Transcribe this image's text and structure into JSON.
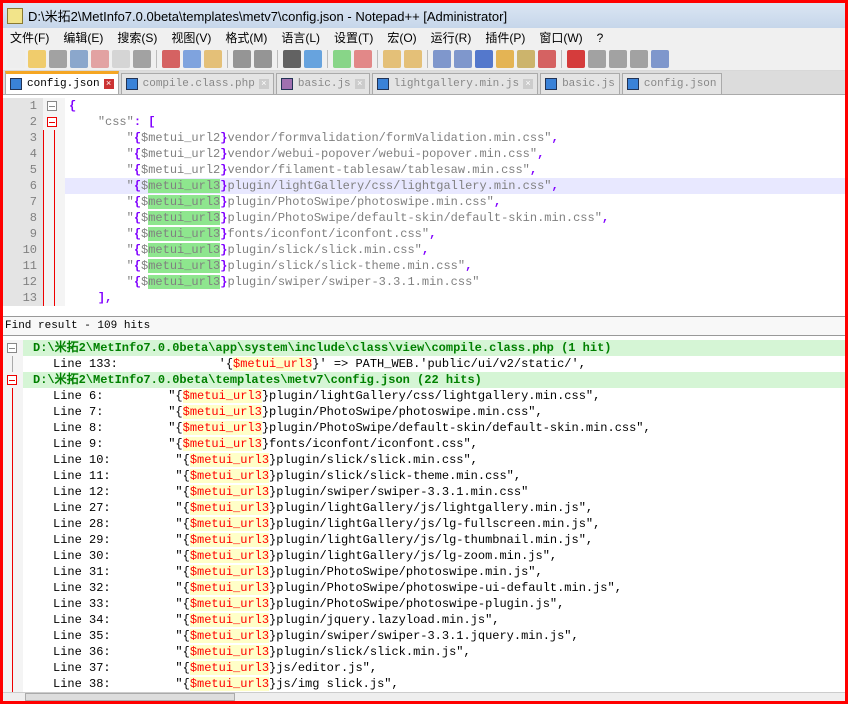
{
  "window": {
    "title": "D:\\米拓2\\MetInfo7.0.0beta\\templates\\metv7\\config.json - Notepad++ [Administrator]"
  },
  "menu": [
    "文件(F)",
    "编辑(E)",
    "搜索(S)",
    "视图(V)",
    "格式(M)",
    "语言(L)",
    "设置(T)",
    "宏(O)",
    "运行(R)",
    "插件(P)",
    "窗口(W)",
    "?"
  ],
  "tabs": [
    {
      "label": "config.json",
      "active": true
    },
    {
      "label": "compile.class.php"
    },
    {
      "label": "basic.js"
    },
    {
      "label": "lightgallery.min.js"
    },
    {
      "label": "basic.js"
    },
    {
      "label": "config.json"
    }
  ],
  "editor": {
    "current_line": 6,
    "highlight": "metui_url3",
    "lines": [
      {
        "n": "1",
        "t": "{"
      },
      {
        "n": "2",
        "t": "    \"css\": ["
      },
      {
        "n": "3",
        "t": "        \"{$metui_url2}vendor/formvalidation/formValidation.min.css\","
      },
      {
        "n": "4",
        "t": "        \"{$metui_url2}vendor/webui-popover/webui-popover.min.css\","
      },
      {
        "n": "5",
        "t": "        \"{$metui_url2}vendor/filament-tablesaw/tablesaw.min.css\","
      },
      {
        "n": "6",
        "t": "        \"{$metui_url3}plugin/lightGallery/css/lightgallery.min.css\","
      },
      {
        "n": "7",
        "t": "        \"{$metui_url3}plugin/PhotoSwipe/photoswipe.min.css\","
      },
      {
        "n": "8",
        "t": "        \"{$metui_url3}plugin/PhotoSwipe/default-skin/default-skin.min.css\","
      },
      {
        "n": "9",
        "t": "        \"{$metui_url3}fonts/iconfont/iconfont.css\","
      },
      {
        "n": "10",
        "t": "        \"{$metui_url3}plugin/slick/slick.min.css\","
      },
      {
        "n": "11",
        "t": "        \"{$metui_url3}plugin/slick/slick-theme.min.css\","
      },
      {
        "n": "12",
        "t": "        \"{$metui_url3}plugin/swiper/swiper-3.3.1.min.css\""
      },
      {
        "n": "13",
        "t": "    ],"
      }
    ]
  },
  "find": {
    "header": "Find result - 109 hits",
    "search": "$metui_url3",
    "rows": [
      {
        "file": "D:\\米拓2\\MetInfo7.0.0beta\\app\\system\\include\\class\\view\\compile.class.php (1 hit)"
      },
      {
        "t": "Line 133:              '{$metui_url3}' => PATH_WEB.'public/ui/v2/static/',"
      },
      {
        "file": "D:\\米拓2\\MetInfo7.0.0beta\\templates\\metv7\\config.json (22 hits)",
        "red": true
      },
      {
        "t": "Line 6:         \"{$metui_url3}plugin/lightGallery/css/lightgallery.min.css\","
      },
      {
        "t": "Line 7:         \"{$metui_url3}plugin/PhotoSwipe/photoswipe.min.css\","
      },
      {
        "t": "Line 8:         \"{$metui_url3}plugin/PhotoSwipe/default-skin/default-skin.min.css\","
      },
      {
        "t": "Line 9:         \"{$metui_url3}fonts/iconfont/iconfont.css\","
      },
      {
        "t": "Line 10:         \"{$metui_url3}plugin/slick/slick.min.css\","
      },
      {
        "t": "Line 11:         \"{$metui_url3}plugin/slick/slick-theme.min.css\","
      },
      {
        "t": "Line 12:         \"{$metui_url3}plugin/swiper/swiper-3.3.1.min.css\""
      },
      {
        "t": "Line 27:         \"{$metui_url3}plugin/lightGallery/js/lightgallery.min.js\","
      },
      {
        "t": "Line 28:         \"{$metui_url3}plugin/lightGallery/js/lg-fullscreen.min.js\","
      },
      {
        "t": "Line 29:         \"{$metui_url3}plugin/lightGallery/js/lg-thumbnail.min.js\","
      },
      {
        "t": "Line 30:         \"{$metui_url3}plugin/lightGallery/js/lg-zoom.min.js\","
      },
      {
        "t": "Line 31:         \"{$metui_url3}plugin/PhotoSwipe/photoswipe.min.js\","
      },
      {
        "t": "Line 32:         \"{$metui_url3}plugin/PhotoSwipe/photoswipe-ui-default.min.js\","
      },
      {
        "t": "Line 33:         \"{$metui_url3}plugin/PhotoSwipe/photoswipe-plugin.js\","
      },
      {
        "t": "Line 34:         \"{$metui_url3}plugin/jquery.lazyload.min.js\","
      },
      {
        "t": "Line 35:         \"{$metui_url3}plugin/swiper/swiper-3.3.1.jquery.min.js\","
      },
      {
        "t": "Line 36:         \"{$metui_url3}plugin/slick/slick.min.js\","
      },
      {
        "t": "Line 37:         \"{$metui_url3}js/editor.js\","
      },
      {
        "t": "Line 38:         \"{$metui_url3}js/img slick.js\","
      }
    ]
  },
  "colors": {
    "frame": "#ff0000",
    "file_bg": "#d5f5d5",
    "match": "#ff0000",
    "smart_highlight": "#8ee68e"
  }
}
